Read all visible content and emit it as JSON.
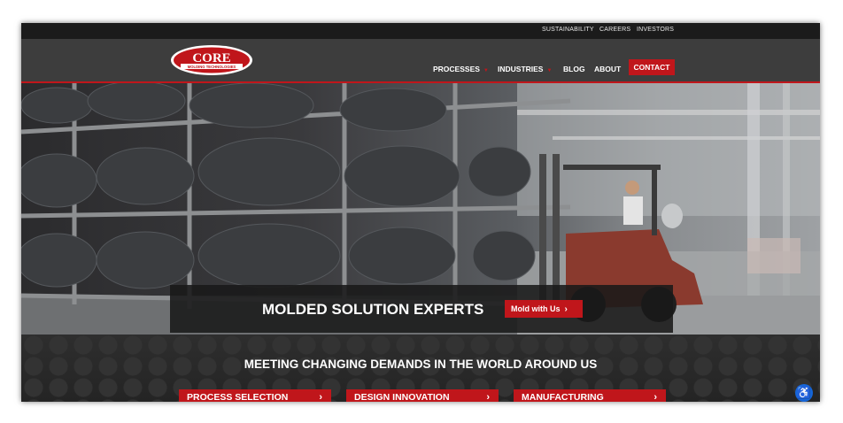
{
  "topbar": {
    "links": [
      "SUSTAINABILITY",
      "CAREERS",
      "INVESTORS"
    ]
  },
  "header": {
    "logo_text": "CORE",
    "logo_subtext": "MOLDING TECHNOLOGIES",
    "nav": {
      "processes": "PROCESSES",
      "industries": "INDUSTRIES",
      "blog": "BLOG",
      "about": "ABOUT",
      "contact": "CONTACT"
    },
    "dropdown_icon": "caret-down-icon"
  },
  "hero": {
    "title": "MOLDED SOLUTION EXPERTS",
    "cta_label": "Mold with Us",
    "cta_icon": "chevron-right-icon",
    "image_subject": "warehouse-forklift-photo"
  },
  "section": {
    "title": "MEETING CHANGING DEMANDS IN THE WORLD AROUND US",
    "cards": [
      {
        "label": "PROCESS SELECTION"
      },
      {
        "label": "DESIGN INNOVATION"
      },
      {
        "label": "MANUFACTURING"
      }
    ],
    "card_icon": "chevron-right-icon"
  },
  "accessibility": {
    "icon": "accessibility-icon"
  },
  "colors": {
    "brand_red": "#c0161b",
    "topbar": "#1b1b1b",
    "header": "#3d3d3d",
    "accessibility_blue": "#1565d8"
  }
}
